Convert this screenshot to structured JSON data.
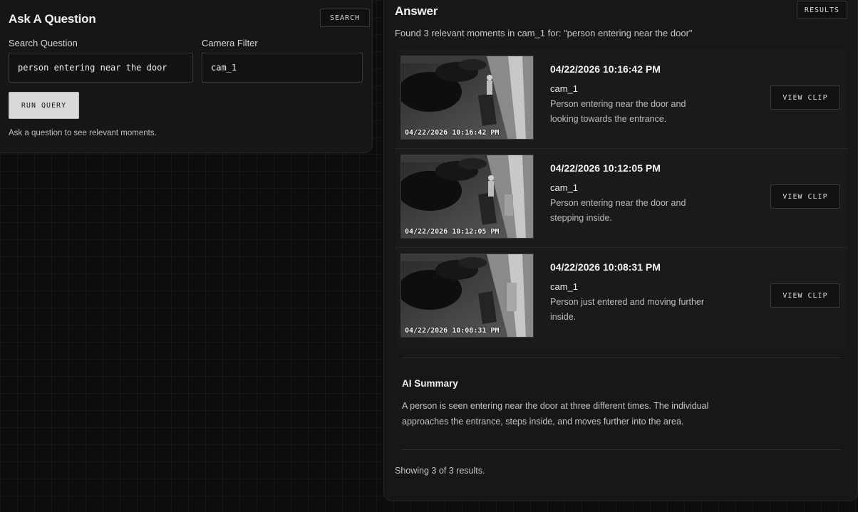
{
  "ask": {
    "title": "Ask A Question",
    "search_tag": "SEARCH",
    "question_label": "Search Question",
    "question_value": "person entering near the door",
    "camera_label": "Camera Filter",
    "camera_value": "cam_1",
    "run_label": "RUN QUERY",
    "hint": "Ask a question to see relevant moments."
  },
  "answer": {
    "title": "Answer",
    "results_tag": "RESULTS",
    "found_text": "Found 3 relevant moments in cam_1 for: \"person entering near the door\"",
    "results": [
      {
        "timestamp": "04/22/2026 10:16:42 PM",
        "camera": "cam_1",
        "description": "Person entering near the door and looking towards the entrance.",
        "view_label": "VIEW CLIP"
      },
      {
        "timestamp": "04/22/2026 10:12:05 PM",
        "camera": "cam_1",
        "description": "Person entering near the door and stepping inside.",
        "view_label": "VIEW CLIP"
      },
      {
        "timestamp": "04/22/2026 10:08:31 PM",
        "camera": "cam_1",
        "description": "Person just entered and moving further inside.",
        "view_label": "VIEW CLIP"
      }
    ],
    "summary_title": "AI Summary",
    "summary_text": "A person is seen entering near the door at three different times. The individual approaches the entrance, steps inside, and moves further into the area.",
    "showing_text": "Showing 3 of 3 results."
  }
}
